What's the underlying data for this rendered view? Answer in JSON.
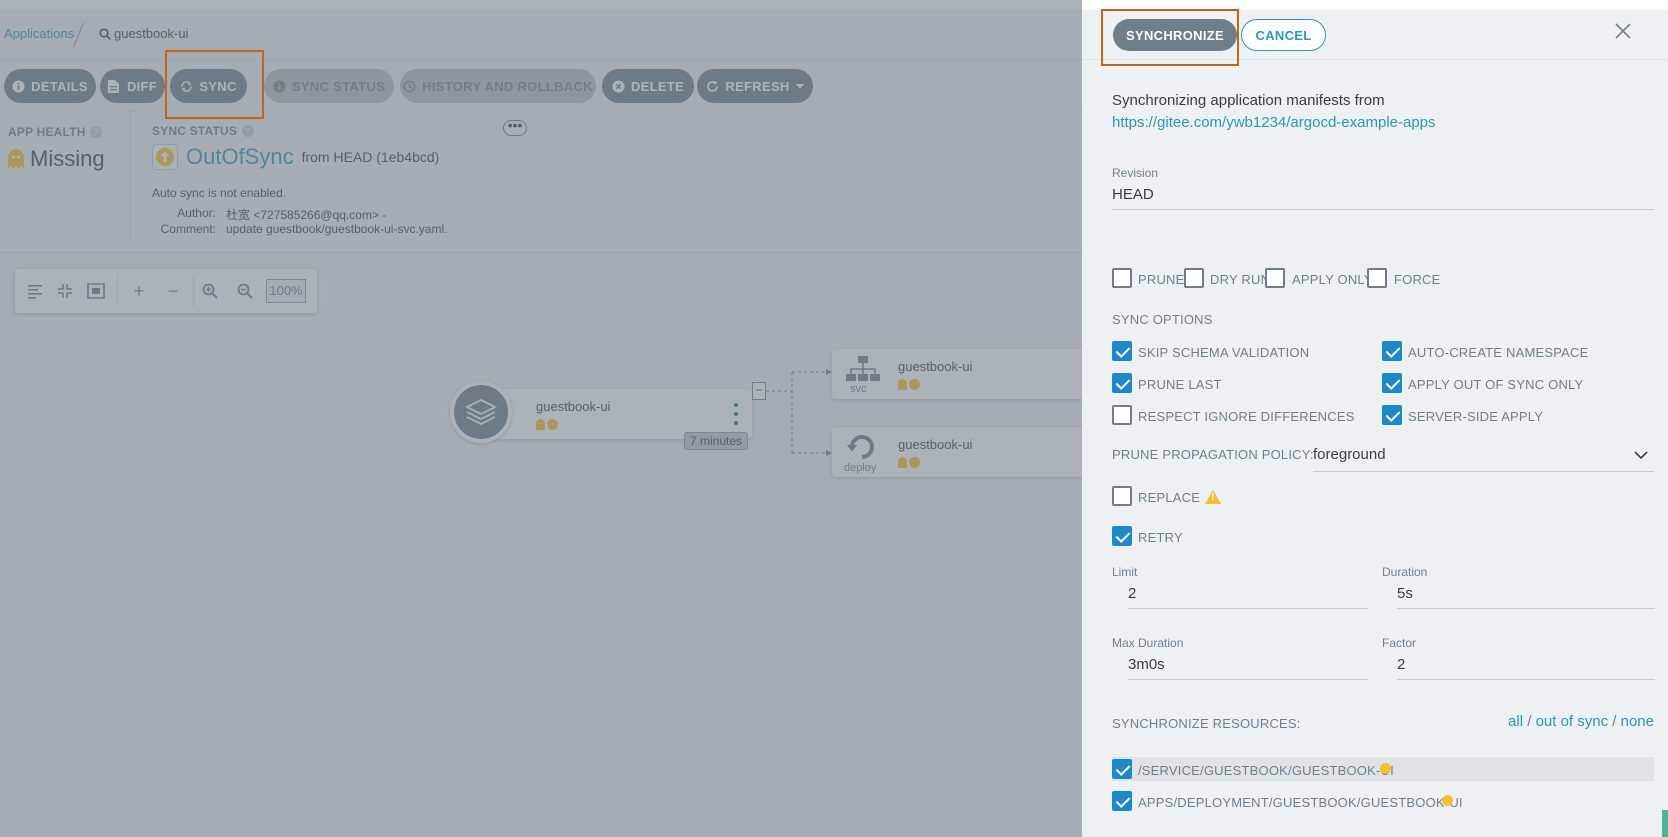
{
  "breadcrumb": {
    "applications": "Applications",
    "current": "guestbook-ui"
  },
  "toolbar": {
    "details": "DETAILS",
    "diff": "DIFF",
    "sync": "SYNC",
    "sync_status": "SYNC STATUS",
    "history": "HISTORY AND ROLLBACK",
    "delete": "DELETE",
    "refresh": "REFRESH"
  },
  "summary": {
    "app_health_label": "APP HEALTH",
    "app_health_value": "Missing",
    "sync_status_label": "SYNC STATUS",
    "sync_status_value": "OutOfSync",
    "from_revision": "from HEAD (1eb4bcd)",
    "auto_sync": "Auto sync is not enabled.",
    "author_label": "Author:",
    "author_value": "杜宽 <727585266@qq.com> -",
    "comment_label": "Comment:",
    "comment_value": "update guestbook/guestbook-ui-svc.yaml."
  },
  "zoom": {
    "level": "100%"
  },
  "graph": {
    "app_node": "guestbook-ui",
    "age": "7 minutes",
    "svc_node": "guestbook-ui",
    "svc_kind": "svc",
    "deploy_node": "guestbook-ui",
    "deploy_kind": "deploy"
  },
  "panel": {
    "synchronize": "SYNCHRONIZE",
    "cancel": "CANCEL",
    "intro": "Synchronizing application manifests from",
    "repo_url": "https://gitee.com/ywb1234/argocd-example-apps",
    "revision_label": "Revision",
    "revision_value": "HEAD",
    "flags": [
      {
        "label": "PRUNE",
        "checked": false
      },
      {
        "label": "DRY RUN",
        "checked": false
      },
      {
        "label": "APPLY ONLY",
        "checked": false
      },
      {
        "label": "FORCE",
        "checked": false
      }
    ],
    "sync_options_label": "SYNC OPTIONS",
    "sync_options": [
      {
        "label": "SKIP SCHEMA VALIDATION",
        "checked": true
      },
      {
        "label": "AUTO-CREATE NAMESPACE",
        "checked": true
      },
      {
        "label": "PRUNE LAST",
        "checked": true
      },
      {
        "label": "APPLY OUT OF SYNC ONLY",
        "checked": true
      },
      {
        "label": "RESPECT IGNORE DIFFERENCES",
        "checked": false
      },
      {
        "label": "SERVER-SIDE APPLY",
        "checked": true
      }
    ],
    "prune_policy_label": "PRUNE PROPAGATION POLICY:",
    "prune_policy_value": "foreground",
    "replace_label": "REPLACE",
    "replace_checked": false,
    "retry_label": "RETRY",
    "retry_checked": true,
    "limit_label": "Limit",
    "limit_value": "2",
    "duration_label": "Duration",
    "duration_value": "5s",
    "max_duration_label": "Max Duration",
    "max_duration_value": "3m0s",
    "factor_label": "Factor",
    "factor_value": "2",
    "sync_resources_label": "SYNCHRONIZE RESOURCES:",
    "select_all": "all",
    "select_out_of_sync": "out of sync",
    "select_none": "none",
    "select_sep": "/",
    "resources": [
      {
        "label": "/SERVICE/GUESTBOOK/GUESTBOOK-UI",
        "checked": true
      },
      {
        "label": "APPS/DEPLOYMENT/GUESTBOOK/GUESTBOOK-UI",
        "checked": true
      }
    ]
  },
  "colors": {
    "accent": "#2e96b3",
    "checkbox": "#1e88c9",
    "highlight": "#c0651a",
    "warning": "#f4c030"
  }
}
